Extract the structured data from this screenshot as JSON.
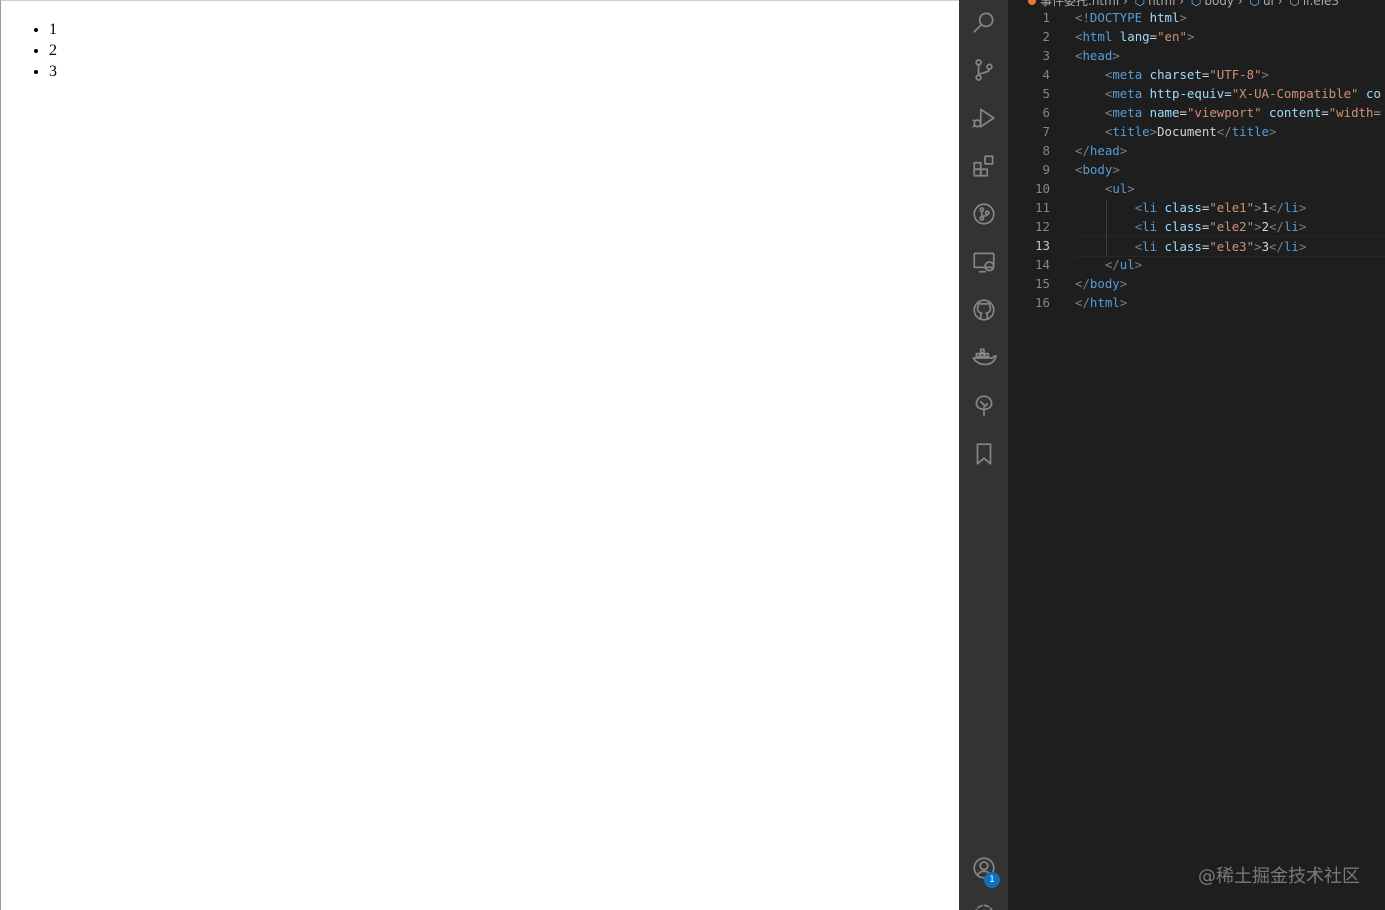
{
  "preview": {
    "list_items": [
      "1",
      "2",
      "3"
    ]
  },
  "activity_bar": {
    "icons": [
      "search-icon",
      "source-control-icon",
      "run-debug-icon",
      "extensions-icon",
      "git-graph-icon",
      "remote-explorer-icon",
      "github-icon",
      "docker-icon",
      "tree-icon",
      "bookmark-icon",
      "account-icon",
      "settings-icon"
    ],
    "account_badge": "1"
  },
  "editor": {
    "active_line": 13,
    "lines": [
      {
        "n": "1",
        "tokens": [
          [
            "br",
            "<!"
          ],
          [
            "tag",
            "DOCTYPE"
          ],
          [
            "txt",
            " "
          ],
          [
            "attr",
            "html"
          ],
          [
            "br",
            ">"
          ]
        ]
      },
      {
        "n": "2",
        "tokens": [
          [
            "br",
            "<"
          ],
          [
            "tag",
            "html"
          ],
          [
            "txt",
            " "
          ],
          [
            "attr",
            "lang"
          ],
          [
            "txt",
            "="
          ],
          [
            "str",
            "\"en\""
          ],
          [
            "br",
            ">"
          ]
        ]
      },
      {
        "n": "3",
        "tokens": [
          [
            "br",
            "<"
          ],
          [
            "tag",
            "head"
          ],
          [
            "br",
            ">"
          ]
        ]
      },
      {
        "n": "4",
        "tokens": [
          [
            "txt",
            "    "
          ],
          [
            "br",
            "<"
          ],
          [
            "tag",
            "meta"
          ],
          [
            "txt",
            " "
          ],
          [
            "attr",
            "charset"
          ],
          [
            "txt",
            "="
          ],
          [
            "str",
            "\"UTF-8\""
          ],
          [
            "br",
            ">"
          ]
        ]
      },
      {
        "n": "5",
        "tokens": [
          [
            "txt",
            "    "
          ],
          [
            "br",
            "<"
          ],
          [
            "tag",
            "meta"
          ],
          [
            "txt",
            " "
          ],
          [
            "attr",
            "http-equiv"
          ],
          [
            "txt",
            "="
          ],
          [
            "str",
            "\"X-UA-Compatible\""
          ],
          [
            "txt",
            " "
          ],
          [
            "attr",
            "co"
          ]
        ]
      },
      {
        "n": "6",
        "tokens": [
          [
            "txt",
            "    "
          ],
          [
            "br",
            "<"
          ],
          [
            "tag",
            "meta"
          ],
          [
            "txt",
            " "
          ],
          [
            "attr",
            "name"
          ],
          [
            "txt",
            "="
          ],
          [
            "str",
            "\"viewport\""
          ],
          [
            "txt",
            " "
          ],
          [
            "attr",
            "content"
          ],
          [
            "txt",
            "="
          ],
          [
            "str",
            "\"width="
          ]
        ]
      },
      {
        "n": "7",
        "tokens": [
          [
            "txt",
            "    "
          ],
          [
            "br",
            "<"
          ],
          [
            "tag",
            "title"
          ],
          [
            "br",
            ">"
          ],
          [
            "txt",
            "Document"
          ],
          [
            "br",
            "</"
          ],
          [
            "tag",
            "title"
          ],
          [
            "br",
            ">"
          ]
        ]
      },
      {
        "n": "8",
        "tokens": [
          [
            "br",
            "</"
          ],
          [
            "tag",
            "head"
          ],
          [
            "br",
            ">"
          ]
        ]
      },
      {
        "n": "9",
        "tokens": [
          [
            "br",
            "<"
          ],
          [
            "tag",
            "body"
          ],
          [
            "br",
            ">"
          ]
        ]
      },
      {
        "n": "10",
        "tokens": [
          [
            "txt",
            "    "
          ],
          [
            "br",
            "<"
          ],
          [
            "tag",
            "ul"
          ],
          [
            "br",
            ">"
          ]
        ]
      },
      {
        "n": "11",
        "tokens": [
          [
            "txt",
            "        "
          ],
          [
            "br",
            "<"
          ],
          [
            "tag",
            "li"
          ],
          [
            "txt",
            " "
          ],
          [
            "attr",
            "class"
          ],
          [
            "txt",
            "="
          ],
          [
            "str",
            "\"ele1\""
          ],
          [
            "br",
            ">"
          ],
          [
            "txt",
            "1"
          ],
          [
            "br",
            "</"
          ],
          [
            "tag",
            "li"
          ],
          [
            "br",
            ">"
          ]
        ]
      },
      {
        "n": "12",
        "tokens": [
          [
            "txt",
            "        "
          ],
          [
            "br",
            "<"
          ],
          [
            "tag",
            "li"
          ],
          [
            "txt",
            " "
          ],
          [
            "attr",
            "class"
          ],
          [
            "txt",
            "="
          ],
          [
            "str",
            "\"ele2\""
          ],
          [
            "br",
            ">"
          ],
          [
            "txt",
            "2"
          ],
          [
            "br",
            "</"
          ],
          [
            "tag",
            "li"
          ],
          [
            "br",
            ">"
          ]
        ]
      },
      {
        "n": "13",
        "tokens": [
          [
            "txt",
            "        "
          ],
          [
            "br",
            "<"
          ],
          [
            "tag",
            "li"
          ],
          [
            "txt",
            " "
          ],
          [
            "attr",
            "class"
          ],
          [
            "txt",
            "="
          ],
          [
            "str",
            "\"ele3\""
          ],
          [
            "br",
            ">"
          ],
          [
            "txt",
            "3"
          ],
          [
            "br",
            "</"
          ],
          [
            "tag",
            "li"
          ],
          [
            "br",
            ">"
          ]
        ]
      },
      {
        "n": "14",
        "tokens": [
          [
            "txt",
            "    "
          ],
          [
            "br",
            "</"
          ],
          [
            "tag",
            "ul"
          ],
          [
            "br",
            ">"
          ]
        ]
      },
      {
        "n": "15",
        "tokens": [
          [
            "br",
            "</"
          ],
          [
            "tag",
            "body"
          ],
          [
            "br",
            ">"
          ]
        ]
      },
      {
        "n": "16",
        "tokens": [
          [
            "br",
            "</"
          ],
          [
            "tag",
            "html"
          ],
          [
            "br",
            ">"
          ]
        ]
      }
    ]
  },
  "watermark": "@稀土掘金技术社区"
}
